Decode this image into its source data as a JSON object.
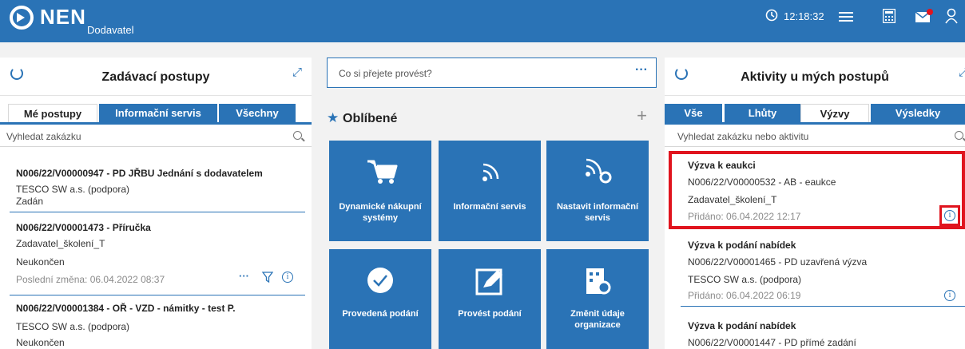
{
  "header": {
    "brand": "NEN",
    "brand_sub": "Dodavatel",
    "clock": "12:18:32"
  },
  "left_panel": {
    "title": "Zadávací postupy",
    "tabs": [
      "Mé postupy",
      "Informační servis",
      "Všechny"
    ],
    "search_placeholder": "Vyhledat zakázku",
    "items": [
      {
        "title": "N006/22/V00000947 - PD JŘBU Jednání s dodavatelem",
        "line1": "TESCO SW a.s. (podpora)",
        "line2": "Zadán"
      },
      {
        "title": "N006/22/V00001473 - Příručka",
        "line1": "Zadavatel_školení_T",
        "line2": "Neukončen",
        "meta": "Poslední změna: 06.04.2022 08:37"
      },
      {
        "title": "N006/22/V00001384 - OŘ - VZD - námitky - test P.",
        "line1": "TESCO SW a.s. (podpora)",
        "line2": "Neukončen"
      }
    ]
  },
  "middle_panel": {
    "ask_placeholder": "Co si přejete provést?",
    "favorites_title": "Oblíbené",
    "tiles": [
      {
        "label": "Dynamické nákupní systémy",
        "icon": "cart-icon"
      },
      {
        "label": "Informační servis",
        "icon": "rss-icon"
      },
      {
        "label": "Nastavit informační servis",
        "icon": "rss-settings-icon"
      },
      {
        "label": "Provedená podání",
        "icon": "check-circle-icon"
      },
      {
        "label": "Provést podání",
        "icon": "edit-icon"
      },
      {
        "label": "Změnit údaje organizace",
        "icon": "building-settings-icon"
      }
    ]
  },
  "right_panel": {
    "title": "Aktivity u mých postupů",
    "tabs": [
      "Vše",
      "Lhůty",
      "Výzvy",
      "Výsledky"
    ],
    "active_tab": "Výzvy",
    "search_placeholder": "Vyhledat zakázku nebo aktivitu",
    "items": [
      {
        "title": "Výzva k eaukci",
        "line1": "N006/22/V00000532 - AB - eaukce",
        "line2": "Zadavatel_školení_T",
        "meta": "Přidáno: 06.04.2022 12:17"
      },
      {
        "title": "Výzva k podání nabídek",
        "line1": "N006/22/V00001465 - PD uzavřená výzva",
        "line2": "TESCO SW a.s. (podpora)",
        "meta": "Přidáno: 06.04.2022 06:19"
      },
      {
        "title": "Výzva k podání nabídek",
        "line1": "N006/22/V00001447 - PD přímé zadání"
      }
    ]
  },
  "colors": {
    "primary": "#2a73b6",
    "highlight": "#e0141e"
  }
}
